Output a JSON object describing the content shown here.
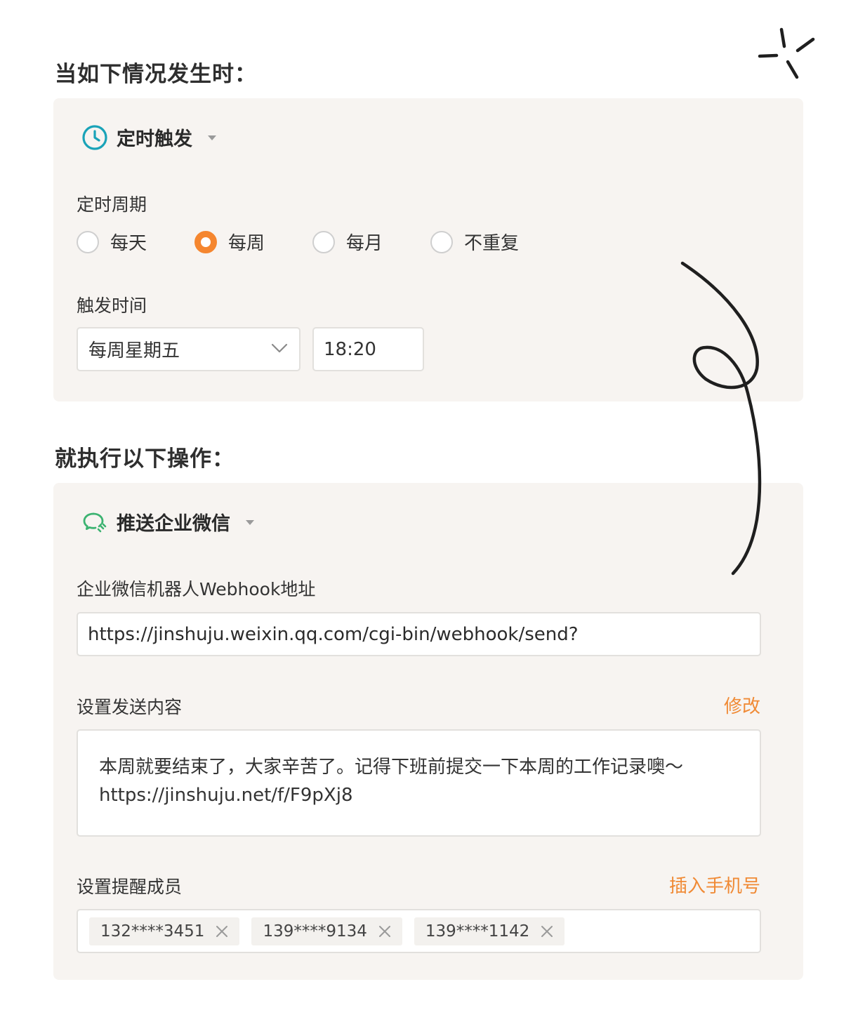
{
  "trigger_section": {
    "title": "当如下情况发生时：",
    "trigger_type": "定时触发",
    "period_label": "定时周期",
    "period_options": [
      {
        "label": "每天",
        "checked": false
      },
      {
        "label": "每周",
        "checked": true
      },
      {
        "label": "每月",
        "checked": false
      },
      {
        "label": "不重复",
        "checked": false
      }
    ],
    "time_label": "触发时间",
    "day_select_value": "每周星期五",
    "time_value": "18:20"
  },
  "action_section": {
    "title": "就执行以下操作：",
    "action_type": "推送企业微信",
    "webhook_label": "企业微信机器人Webhook地址",
    "webhook_value": "https://jinshuju.weixin.qq.com/cgi-bin/webhook/send?",
    "content_label": "设置发送内容",
    "content_edit_link": "修改",
    "content_line1": "本周就要结束了，大家辛苦了。记得下班前提交一下本周的工作记录噢～",
    "content_line2": "https://jinshuju.net/f/F9pXj8",
    "members_label": "设置提醒成员",
    "members_insert_link": "插入手机号",
    "members": [
      "132****3451",
      "139****9134",
      "139****1142"
    ]
  },
  "colors": {
    "accent_orange": "#f5862f",
    "link_orange": "#f08a35",
    "clock_teal": "#1aa3b8",
    "wechat_green": "#3cb371",
    "panel_bg": "#f7f4f1"
  },
  "icons": {
    "trigger_icon": "clock-icon",
    "action_icon": "wechat-work-icon",
    "tag_remove_icon": "close-icon",
    "select_icon": "chevron-down-icon"
  }
}
